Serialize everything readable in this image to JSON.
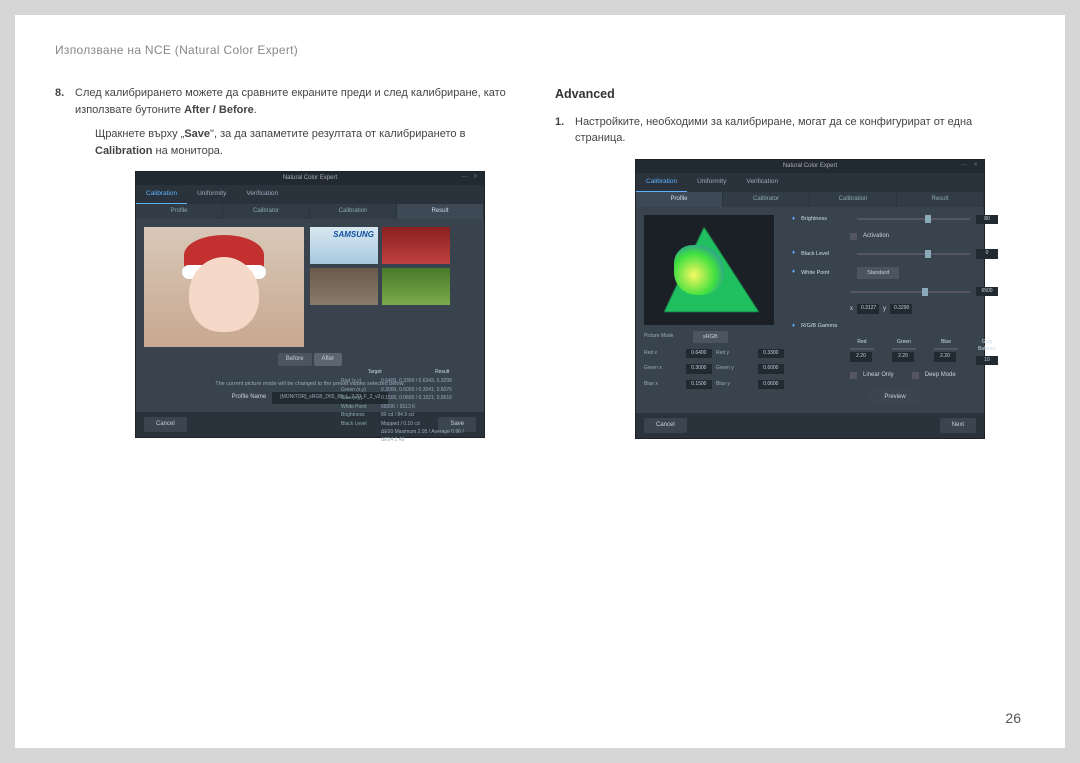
{
  "header": "Използване на NCE (Natural Color Expert)",
  "page_number": "26",
  "left": {
    "item8": {
      "num": "8.",
      "text_a": "След калибрирането можете да сравните екраните преди и след калибриране, като използвате бутоните ",
      "bold_a": "After / Before",
      "text_b": ".",
      "sub_a": "Щракнете върху „",
      "sub_bold": "Save",
      "sub_b": "\", за да запаметите резултата от калибрирането в ",
      "sub_bold2": "Calibration",
      "sub_c": " на монитора."
    }
  },
  "right": {
    "section": "Advanced",
    "item1": {
      "num": "1.",
      "text": "Настройките, необходими за калибриране, могат да се конфигурират от една страница."
    }
  },
  "app1": {
    "title": "Natural Color Expert",
    "tabs": {
      "calibration": "Calibration",
      "uniformity": "Uniformity",
      "verification": "Verification"
    },
    "subtabs": {
      "profile": "Profile",
      "calibrator": "Calibrator",
      "calibration": "Calibration",
      "result": "Result"
    },
    "logo": "SAMSUNG",
    "toggle": {
      "before": "Before",
      "after": "After"
    },
    "data": {
      "hdr_target": "Target",
      "hdr_result": "Result",
      "rows": [
        {
          "label": "Red (x,y)",
          "val": "0.6400, 0.3300 / 0.6343, 0.3298"
        },
        {
          "label": "Green (x,y)",
          "val": "0.3000, 0.6000 / 0.3041, 0.6076"
        },
        {
          "label": "Blue (x,y)",
          "val": "0.1500, 0.0600 / 0.1521, 0.0616"
        },
        {
          "label": "White Point",
          "val": "6500K / 6513 K"
        },
        {
          "label": "Brightness",
          "val": "80 cd / 84.9 cd"
        },
        {
          "label": "Black Level",
          "val": "Mapped / 0.10 cd"
        },
        {
          "label": "",
          "val": "ΔE00 Maximum 2.95 / Average 0.96 / ΔE94 2.48"
        }
      ]
    },
    "msg": "The current picture mode will be changed to the preset values selected below.",
    "profile_label": "Profile Name",
    "profile_value": "[MONITOR]_sRGB_D65_80_L_2.20_F_2_v2",
    "cancel": "Cancel",
    "save": "Save"
  },
  "app2": {
    "title": "Natural Color Expert",
    "ctrls": {
      "brightness": "Brightness",
      "brightness_val": "80",
      "activation": "Activation",
      "black": "Black Level",
      "black_val": "0",
      "white": "White Point",
      "white_sel": "Standard",
      "white_val": "6500",
      "xval": "0.3127",
      "yval": "0.3290"
    },
    "left": {
      "picture_mode": "Picture Mode",
      "picture_sel": "sRGB",
      "redx": "Red x",
      "redx_v": "0.6400",
      "redy": "Red y",
      "redy_v": "0.3300",
      "grnx": "Green x",
      "grnx_v": "0.3000",
      "grny": "Green y",
      "grny_v": "0.6000",
      "blux": "Blue x",
      "blux_v": "0.1500",
      "bluy": "Blue y",
      "bluy_v": "0.0600"
    },
    "rgb": {
      "label": "R/G/B Gamma",
      "red": "Red",
      "green": "Green",
      "blue": "Blue",
      "rv": "2.20",
      "gv": "2.20",
      "bv": "2.20",
      "gray": "Gray Balance",
      "grayv": "10"
    },
    "opts": {
      "linear": "Linear Only",
      "deep": "Deep Mode"
    },
    "preview": "Preview",
    "cancel": "Cancel",
    "next": "Next"
  }
}
